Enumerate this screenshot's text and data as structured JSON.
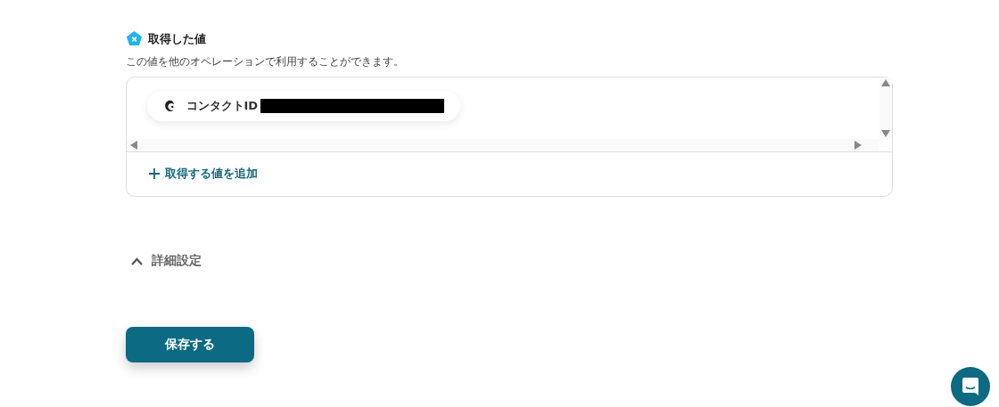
{
  "section": {
    "title": "取得した値",
    "description": "この値を他のオペレーションで利用することができます。",
    "values": [
      {
        "label": "コンタクトID",
        "redacted": true
      }
    ],
    "add_link": "取得する値を追加"
  },
  "advanced": {
    "label": "詳細設定",
    "expanded": true
  },
  "save_button": "保存する"
}
